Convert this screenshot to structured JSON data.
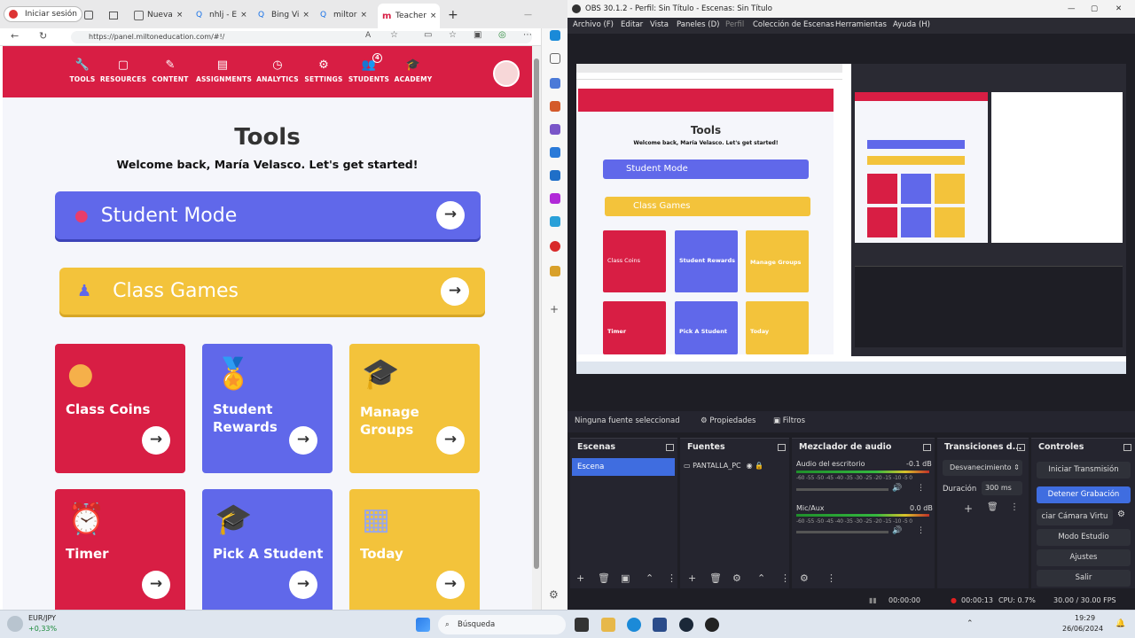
{
  "browser": {
    "profile_label": "Iniciar sesión",
    "tabs": [
      {
        "label": "Nueva"
      },
      {
        "label": "nhlj - E"
      },
      {
        "label": "Bing Vi"
      },
      {
        "label": "miltor"
      },
      {
        "label": "Teacher"
      }
    ],
    "url": "https://panel.miltoneducation.com/#!/"
  },
  "app": {
    "nav": [
      {
        "label": "TOOLS",
        "icon": "wrench-icon"
      },
      {
        "label": "RESOURCES",
        "icon": "folder-icon"
      },
      {
        "label": "CONTENT",
        "icon": "pencil-icon"
      },
      {
        "label": "ASSIGNMENTS",
        "icon": "document-icon"
      },
      {
        "label": "ANALYTICS",
        "icon": "clock-icon"
      },
      {
        "label": "SETTINGS",
        "icon": "gear-icon"
      },
      {
        "label": "STUDENTS",
        "icon": "students-icon",
        "badge": "4"
      },
      {
        "label": "ACADEMY",
        "icon": "graduation-cap-icon"
      }
    ],
    "title": "Tools",
    "welcome": "Welcome back, María Velasco. Let's get started!",
    "student_mode": "Student Mode",
    "class_games": "Class Games",
    "cards": [
      {
        "label": "Class Coins",
        "color": "#d81e44",
        "icon": "coin-icon"
      },
      {
        "label": "Student Rewards",
        "color": "#6068ea",
        "icon": "medal-icon"
      },
      {
        "label": "Manage Groups",
        "color": "#f3c33b",
        "icon": "graduates-icon"
      },
      {
        "label": "Timer",
        "color": "#d81e44",
        "icon": "alarm-clock-icon"
      },
      {
        "label": "Pick A Student",
        "color": "#6068ea",
        "icon": "student-icon"
      },
      {
        "label": "Today",
        "color": "#f3c33b",
        "icon": "calendar-icon"
      }
    ]
  },
  "obs": {
    "title": "OBS 30.1.2 - Perfil: Sin Título - Escenas: Sin Título",
    "menu": [
      "Archivo (F)",
      "Editar",
      "Vista",
      "Paneles (D)",
      "Perfil",
      "Colección de Escenas",
      "Herramientas",
      "Ayuda (H)"
    ],
    "no_source": "Ninguna fuente seleccionad",
    "properties": "Propiedades",
    "filters": "Filtros",
    "docks": {
      "scenes": "Escenas",
      "sources": "Fuentes",
      "mixer": "Mezclador de audio",
      "transitions": "Transiciones d...",
      "controls": "Controles"
    },
    "scene_item": "Escena",
    "source_item": "PANTALLA_PC",
    "mixer": [
      {
        "name": "Audio del escritorio",
        "db": "-0.1 dB"
      },
      {
        "name": "Mic/Aux",
        "db": "0.0 dB"
      }
    ],
    "mixer_scale": "-60 -55 -50 -45 -40 -35 -30 -25 -20 -15 -10 -5 0",
    "transition": "Desvanecimiento",
    "duration_label": "Duración",
    "duration": "300 ms",
    "controls": [
      "Iniciar Transmisión",
      "Detener Grabación",
      "ciar Cámara Virtu",
      "Modo Estudio",
      "Ajustes",
      "Salir"
    ],
    "status": {
      "stream_time": "00:00:00",
      "rec_time": "00:00:13",
      "cpu": "CPU: 0.7%",
      "fps": "30.00 / 30.00 FPS"
    }
  },
  "taskbar": {
    "ticker": "EUR/JPY",
    "change": "+0,33%",
    "search": "Búsqueda",
    "time": "19:29",
    "date": "26/06/2024"
  },
  "preview": {
    "title": "Tools",
    "welcome": "Welcome back, María Velasco. Let's get started!",
    "student_mode": "Student Mode",
    "class_games": "Class Games",
    "cards": [
      "Class Coins",
      "Student Rewards",
      "Manage Groups",
      "Timer",
      "Pick A Student",
      "Today"
    ]
  }
}
